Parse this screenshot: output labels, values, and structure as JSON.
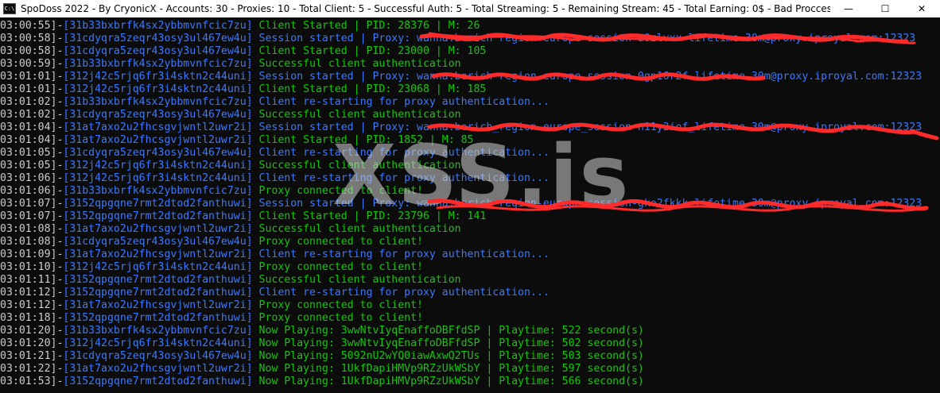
{
  "window": {
    "icon_text": "C:\\",
    "title": "SpoDoss 2022 - By CryonicX - Accounts: 30 - Proxies: 10 - Total Client: 5 - Successful Auth: 5 - Total Streaming: 5 - Remaining Stream: 45 - Total Earning: 0$ - Bad Procces: 0",
    "minimize": "—",
    "maximize": "☐",
    "close": "✕"
  },
  "colors": {
    "background": "#0c0c0c",
    "timestamp": "#cccccc",
    "green": "#16c60c",
    "blue": "#3b78ff",
    "redact": "#ff2a2a"
  },
  "watermark": "XSS.is",
  "log": [
    {
      "ts": "03:00:55]-",
      "acc": "[31b33bxbrfk4sx2ybbmvnfcic7zu]",
      "msg": " Client Started | PID: 28376 | M: 26",
      "color": "green"
    },
    {
      "ts": "03:00:58]-",
      "acc": "[31cdyqra5zeqr43osy3ul467ew4u]",
      "msg": " Session started | Proxy: wanna:berich region-europe session-a0zlvxx lifetime-30m@proxy.iproyal.com:12323",
      "color": "blue"
    },
    {
      "ts": "03:00:58]-",
      "acc": "[31cdyqra5zeqr43osy3ul467ew4u]",
      "msg": " Client Started | PID: 23000 | M: 105",
      "color": "green"
    },
    {
      "ts": "03:00:59]-",
      "acc": "[31b33bxbrfk4sx2ybbmvnfcic7zu]",
      "msg": " Successful client authentication",
      "color": "green"
    },
    {
      "ts": "03:01:01]-",
      "acc": "[312j42c5rjq6fr3i4sktn2c44uni]",
      "msg": " Session started | Proxy: wanna:berich region-europe session-0gp16r2f lifetime-30m@proxy.iproyal.com:12323",
      "color": "blue"
    },
    {
      "ts": "03:01:01]-",
      "acc": "[312j42c5rjq6fr3i4sktn2c44uni]",
      "msg": " Client Started | PID: 23068 | M: 185",
      "color": "green"
    },
    {
      "ts": "03:01:02]-",
      "acc": "[31b33bxbrfk4sx2ybbmvnfcic7zu]",
      "msg": " Client re-starting for proxy authentication...",
      "color": "blue"
    },
    {
      "ts": "03:01:02]-",
      "acc": "[31cdyqra5zeqr43osy3ul467ew4u]",
      "msg": " Successful client authentication",
      "color": "green"
    },
    {
      "ts": "03:01:04]-",
      "acc": "[31at7axo2u2fhcsgvjwntl2uwr2i]",
      "msg": " Session started | Proxy: wanna:berich_region-europe_session-n11y2iof_lifetime-30m@proxy.iproyal.com:12323",
      "color": "blue"
    },
    {
      "ts": "03:01:04]-",
      "acc": "[31at7axo2u2fhcsgvjwntl2uwr2i]",
      "msg": " Client Started | PID: 1852 | M: 85",
      "color": "green"
    },
    {
      "ts": "03:01:05]-",
      "acc": "[31cdyqra5zeqr43osy3ul467ew4u]",
      "msg": " Client re-starting for proxy authentication...",
      "color": "blue"
    },
    {
      "ts": "03:01:05]-",
      "acc": "[312j42c5rjq6fr3i4sktn2c44uni]",
      "msg": " Successful client authentication",
      "color": "green"
    },
    {
      "ts": "03:01:06]-",
      "acc": "[312j42c5rjq6fr3i4sktn2c44uni]",
      "msg": " Client re-starting for proxy authentication...",
      "color": "blue"
    },
    {
      "ts": "03:01:06]-",
      "acc": "[31b33bxbrfk4sx2ybbmvnfcic7zu]",
      "msg": " Proxy connected to client!",
      "color": "green"
    },
    {
      "ts": "03:01:07]-",
      "acc": "[3152qpgqne7rmt2dtod2fanthuwi]",
      "msg": " Session started | Proxy: wanna:berich region-europe session-gke2fkkk lifetime-30m@proxy.iproyal.com:12323",
      "color": "blue"
    },
    {
      "ts": "03:01:07]-",
      "acc": "[3152qpgqne7rmt2dtod2fanthuwi]",
      "msg": " Client Started | PID: 23796 | M: 141",
      "color": "green"
    },
    {
      "ts": "03:01:08]-",
      "acc": "[31at7axo2u2fhcsgvjwntl2uwr2i]",
      "msg": " Successful client authentication",
      "color": "green"
    },
    {
      "ts": "03:01:08]-",
      "acc": "[31cdyqra5zeqr43osy3ul467ew4u]",
      "msg": " Proxy connected to client!",
      "color": "green"
    },
    {
      "ts": "03:01:09]-",
      "acc": "[31at7axo2u2fhcsgvjwntl2uwr2i]",
      "msg": " Client re-starting for proxy authentication...",
      "color": "blue"
    },
    {
      "ts": "03:01:10]-",
      "acc": "[312j42c5rjq6fr3i4sktn2c44uni]",
      "msg": " Proxy connected to client!",
      "color": "green"
    },
    {
      "ts": "03:01:11]-",
      "acc": "[3152qpgqne7rmt2dtod2fanthuwi]",
      "msg": " Successful client authentication",
      "color": "green"
    },
    {
      "ts": "03:01:12]-",
      "acc": "[3152qpgqne7rmt2dtod2fanthuwi]",
      "msg": " Client re-starting for proxy authentication...",
      "color": "blue"
    },
    {
      "ts": "03:01:12]-",
      "acc": "[31at7axo2u2fhcsgvjwntl2uwr2i]",
      "msg": " Proxy connected to client!",
      "color": "green"
    },
    {
      "ts": "03:01:18]-",
      "acc": "[3152qpgqne7rmt2dtod2fanthuwi]",
      "msg": " Proxy connected to client!",
      "color": "green"
    },
    {
      "ts": "03:01:20]-",
      "acc": "[31b33bxbrfk4sx2ybbmvnfcic7zu]",
      "msg": " Now Playing: 3wwNtvIyqEnaffoDBFfdSP | Playtime: 522 second(s)",
      "color": "green"
    },
    {
      "ts": "03:01:20]-",
      "acc": "[312j42c5rjq6fr3i4sktn2c44uni]",
      "msg": " Now Playing: 3wwNtvIyqEnaffoDBFfdSP | Playtime: 502 second(s)",
      "color": "green"
    },
    {
      "ts": "03:01:21]-",
      "acc": "[31cdyqra5zeqr43osy3ul467ew4u]",
      "msg": " Now Playing: 5092nU2wYQ0iawAxwQ2TUs | Playtime: 503 second(s)",
      "color": "green"
    },
    {
      "ts": "03:01:22]-",
      "acc": "[31at7axo2u2fhcsgvjwntl2uwr2i]",
      "msg": " Now Playing: 1UkfDapiHMVp9RZzUkWSbY | Playtime: 597 second(s)",
      "color": "green"
    },
    {
      "ts": "03:01:53]-",
      "acc": "[3152qpgqne7rmt2dtod2fanthuwi]",
      "msg": " Now Playing: 1UkfDapiHMVp9RZzUkWSbY | Playtime: 566 second(s)",
      "color": "green"
    }
  ]
}
